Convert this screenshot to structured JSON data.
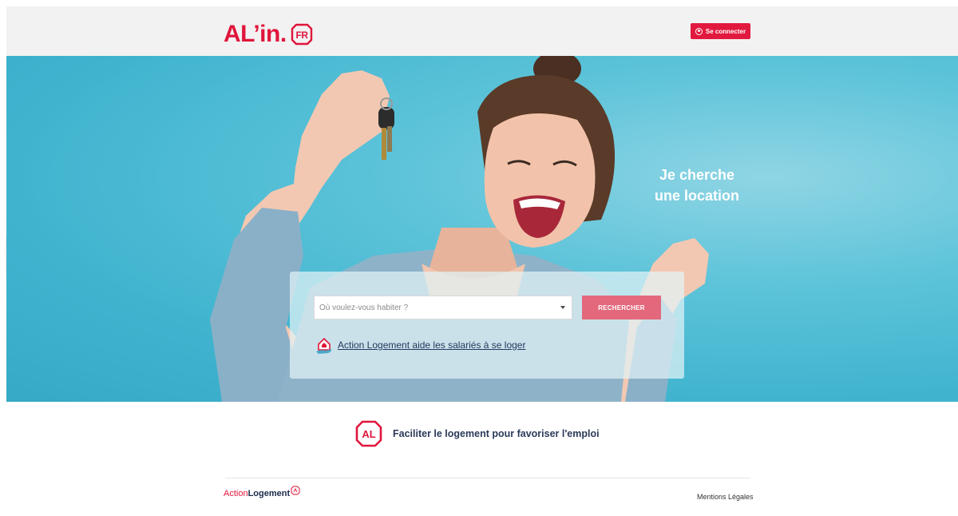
{
  "header": {
    "logo_text": "AL’in.",
    "logo_badge": "FR",
    "login_label": "Se connecter"
  },
  "hero": {
    "title_line1": "Je cherche",
    "title_line2": "une location"
  },
  "search": {
    "placeholder": "Où voulez-vous habiter ?",
    "button_label": "RECHERCHER",
    "aid_link": "Action Logement aide les salariés à se loger"
  },
  "tagline": {
    "icon_text": "AL",
    "text": "Faciliter le logement pour favoriser l'emploi"
  },
  "footer": {
    "logo_part1": "Action",
    "logo_part2": "Logement",
    "legal_link": "Mentions Légales"
  },
  "colors": {
    "brand_red": "#e0153b",
    "button_pink": "#e3687c",
    "hero_blue": "#40b4cf",
    "navy": "#2b3a59"
  }
}
